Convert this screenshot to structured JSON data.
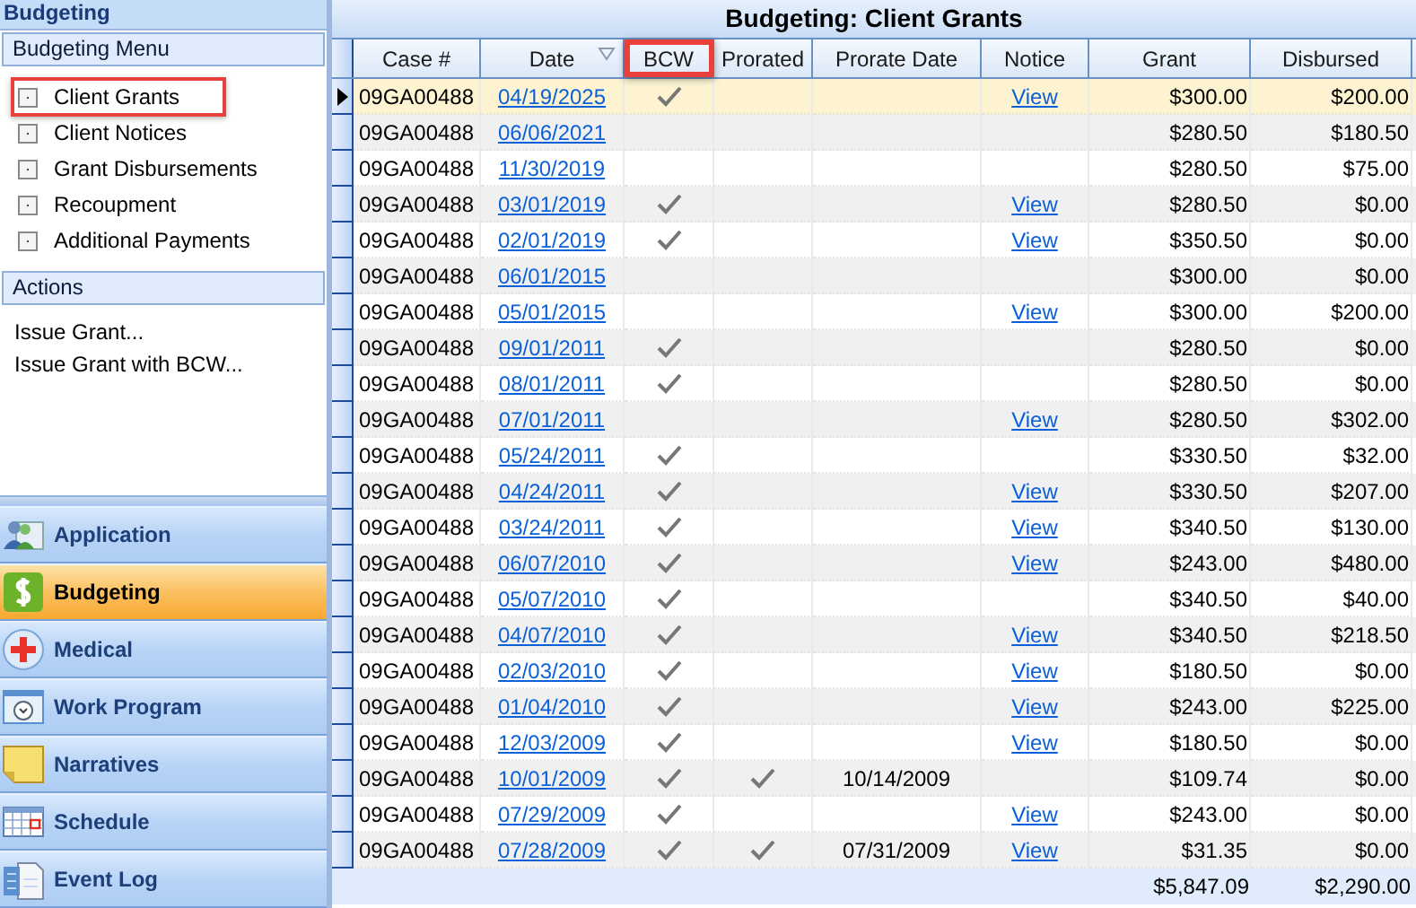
{
  "sidebar": {
    "title": "Budgeting",
    "menu": {
      "header": "Budgeting Menu",
      "items": [
        {
          "label": "Client Grants",
          "highlighted": true
        },
        {
          "label": "Client Notices",
          "highlighted": false
        },
        {
          "label": "Grant Disbursements",
          "highlighted": false
        },
        {
          "label": "Recoupment",
          "highlighted": false
        },
        {
          "label": "Additional Payments",
          "highlighted": false
        }
      ]
    },
    "actions": {
      "header": "Actions",
      "items": [
        "Issue Grant...",
        "Issue Grant with BCW..."
      ]
    },
    "nav": [
      {
        "label": "Application",
        "selected": false
      },
      {
        "label": "Budgeting",
        "selected": true
      },
      {
        "label": "Medical",
        "selected": false
      },
      {
        "label": "Work Program",
        "selected": false
      },
      {
        "label": "Narratives",
        "selected": false
      },
      {
        "label": "Schedule",
        "selected": false
      },
      {
        "label": "Event Log",
        "selected": false
      }
    ]
  },
  "grid": {
    "title": "Budgeting: Client Grants",
    "columns": [
      {
        "label": "Case #",
        "sorted": false,
        "highlighted": false
      },
      {
        "label": "Date",
        "sorted": true,
        "highlighted": false
      },
      {
        "label": "BCW",
        "sorted": false,
        "highlighted": true
      },
      {
        "label": "Prorated",
        "sorted": false,
        "highlighted": false
      },
      {
        "label": "Prorate Date",
        "sorted": false,
        "highlighted": false
      },
      {
        "label": "Notice",
        "sorted": false,
        "highlighted": false
      },
      {
        "label": "Grant",
        "sorted": false,
        "highlighted": false
      },
      {
        "label": "Disbursed",
        "sorted": false,
        "highlighted": false
      }
    ],
    "rows": [
      {
        "case": "09GA00488",
        "date": "04/19/2025",
        "bcw": true,
        "prorated": false,
        "notice": "View",
        "grant": "$300.00",
        "disbursed": "$200.00",
        "selected": true
      },
      {
        "case": "09GA00488",
        "date": "06/06/2021",
        "bcw": false,
        "prorated": false,
        "grant": "$280.50",
        "disbursed": "$180.50",
        "selected": false
      },
      {
        "case": "09GA00488",
        "date": "11/30/2019",
        "bcw": false,
        "prorated": false,
        "grant": "$280.50",
        "disbursed": "$75.00",
        "selected": false
      },
      {
        "case": "09GA00488",
        "date": "03/01/2019",
        "bcw": true,
        "prorated": false,
        "notice": "View",
        "grant": "$280.50",
        "disbursed": "$0.00",
        "selected": false
      },
      {
        "case": "09GA00488",
        "date": "02/01/2019",
        "bcw": true,
        "prorated": false,
        "notice": "View",
        "grant": "$350.50",
        "disbursed": "$0.00",
        "selected": false
      },
      {
        "case": "09GA00488",
        "date": "06/01/2015",
        "bcw": false,
        "prorated": false,
        "grant": "$300.00",
        "disbursed": "$0.00",
        "selected": false
      },
      {
        "case": "09GA00488",
        "date": "05/01/2015",
        "bcw": false,
        "prorated": false,
        "notice": "View",
        "grant": "$300.00",
        "disbursed": "$200.00",
        "selected": false
      },
      {
        "case": "09GA00488",
        "date": "09/01/2011",
        "bcw": true,
        "prorated": false,
        "grant": "$280.50",
        "disbursed": "$0.00",
        "selected": false
      },
      {
        "case": "09GA00488",
        "date": "08/01/2011",
        "bcw": true,
        "prorated": false,
        "grant": "$280.50",
        "disbursed": "$0.00",
        "selected": false
      },
      {
        "case": "09GA00488",
        "date": "07/01/2011",
        "bcw": false,
        "prorated": false,
        "notice": "View",
        "grant": "$280.50",
        "disbursed": "$302.00",
        "selected": false
      },
      {
        "case": "09GA00488",
        "date": "05/24/2011",
        "bcw": true,
        "prorated": false,
        "grant": "$330.50",
        "disbursed": "$32.00",
        "selected": false
      },
      {
        "case": "09GA00488",
        "date": "04/24/2011",
        "bcw": true,
        "prorated": false,
        "notice": "View",
        "grant": "$330.50",
        "disbursed": "$207.00",
        "selected": false
      },
      {
        "case": "09GA00488",
        "date": "03/24/2011",
        "bcw": true,
        "prorated": false,
        "notice": "View",
        "grant": "$340.50",
        "disbursed": "$130.00",
        "selected": false
      },
      {
        "case": "09GA00488",
        "date": "06/07/2010",
        "bcw": true,
        "prorated": false,
        "notice": "View",
        "grant": "$243.00",
        "disbursed": "$480.00",
        "selected": false
      },
      {
        "case": "09GA00488",
        "date": "05/07/2010",
        "bcw": true,
        "prorated": false,
        "grant": "$340.50",
        "disbursed": "$40.00",
        "selected": false
      },
      {
        "case": "09GA00488",
        "date": "04/07/2010",
        "bcw": true,
        "prorated": false,
        "notice": "View",
        "grant": "$340.50",
        "disbursed": "$218.50",
        "selected": false
      },
      {
        "case": "09GA00488",
        "date": "02/03/2010",
        "bcw": true,
        "prorated": false,
        "notice": "View",
        "grant": "$180.50",
        "disbursed": "$0.00",
        "selected": false
      },
      {
        "case": "09GA00488",
        "date": "01/04/2010",
        "bcw": true,
        "prorated": false,
        "notice": "View",
        "grant": "$243.00",
        "disbursed": "$225.00",
        "selected": false
      },
      {
        "case": "09GA00488",
        "date": "12/03/2009",
        "bcw": true,
        "prorated": false,
        "notice": "View",
        "grant": "$180.50",
        "disbursed": "$0.00",
        "selected": false
      },
      {
        "case": "09GA00488",
        "date": "10/01/2009",
        "bcw": true,
        "prorated": true,
        "prorate_date": "10/14/2009",
        "grant": "$109.74",
        "disbursed": "$0.00",
        "selected": false
      },
      {
        "case": "09GA00488",
        "date": "07/29/2009",
        "bcw": true,
        "prorated": false,
        "notice": "View",
        "grant": "$243.00",
        "disbursed": "$0.00",
        "selected": false
      },
      {
        "case": "09GA00488",
        "date": "07/28/2009",
        "bcw": true,
        "prorated": true,
        "prorate_date": "07/31/2009",
        "notice": "View",
        "grant": "$31.35",
        "disbursed": "$0.00",
        "selected": false
      }
    ],
    "totals": {
      "grant": "$5,847.09",
      "disbursed": "$2,290.00"
    }
  }
}
